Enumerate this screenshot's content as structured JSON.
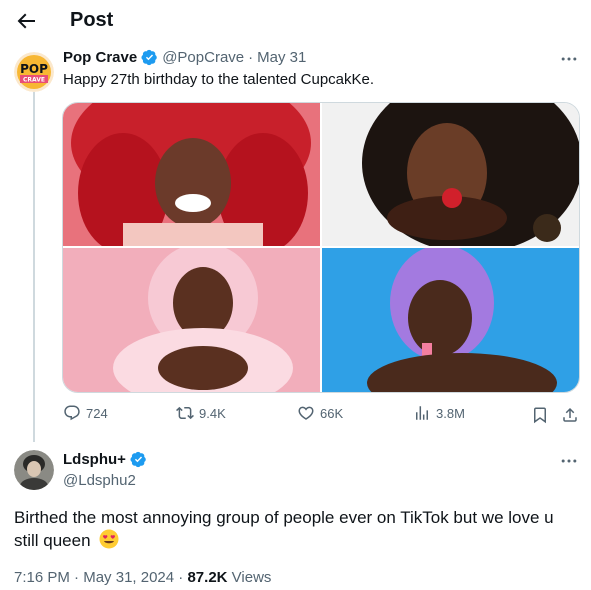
{
  "header": {
    "title": "Post"
  },
  "original_tweet": {
    "avatar_text_top": "POP",
    "avatar_text_bottom": "CRAVE",
    "name": "Pop Crave",
    "handle": "@PopCrave",
    "separator": "·",
    "date": "May 31",
    "text": "Happy 27th birthday to the talented CupcakKe.",
    "stats": {
      "replies": "724",
      "reposts": "9.4K",
      "likes": "66K",
      "views": "3.8M"
    },
    "colors": {
      "verified": "#1d9bf0",
      "brand_orange": "#f5a623"
    }
  },
  "reply": {
    "name": "Ldsphu+",
    "handle": "@Ldsphu2",
    "text": "Birthed the most annoying group of people ever on TikTok but we love u still queen",
    "emoji": "heart-eyes-emoji",
    "time": "7:16 PM",
    "date": "May 31, 2024",
    "views_count": "87.2K",
    "views_label": "Views"
  }
}
